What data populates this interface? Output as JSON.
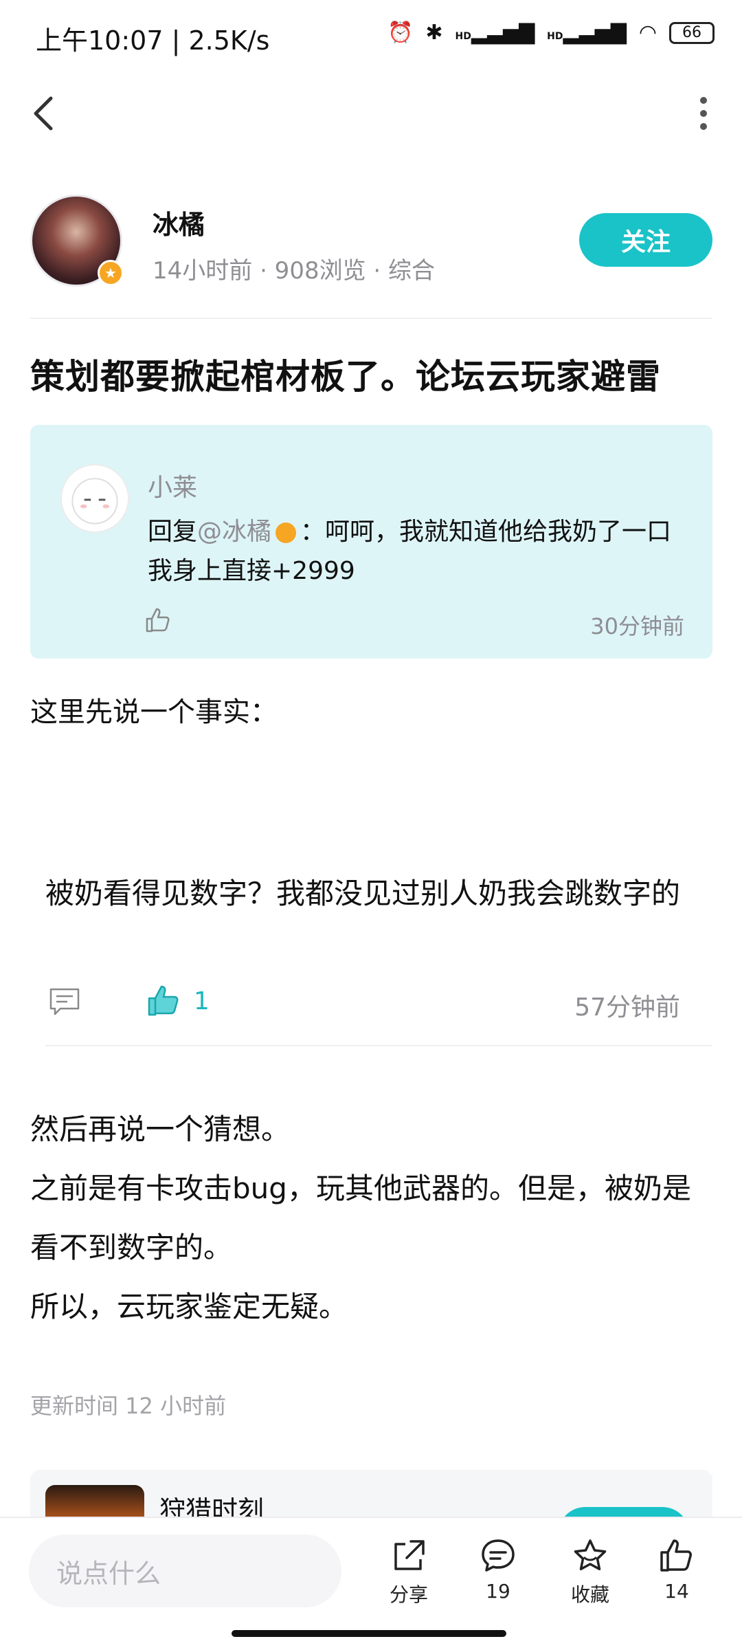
{
  "status_bar": {
    "time": "上午10:07 | 2.5K/s",
    "battery": "66",
    "hd1": "HD",
    "hd2": "HD"
  },
  "post": {
    "author": "冰橘",
    "meta": "14小时前 · 908浏览 · 综合",
    "follow_label": "关注",
    "title": "策划都要掀起棺材板了。论坛云玩家避雷",
    "quote": {
      "name": "小莱",
      "reply_prefix": "回复",
      "reply_at": "@冰橘",
      "text_after_badge": "：呵呵，我就知道他给我奶了一口 我身上直接+2999",
      "time": "30分钟前"
    },
    "para1": "这里先说一个事实：",
    "comment": {
      "text": "被奶看得见数字？我都没见过别人奶我会跳数字的",
      "like_count": "1",
      "time": "57分钟前"
    },
    "body_lines": [
      "然后再说一个猜想。",
      "之前是有卡攻击bug，玩其他武器的。但是，被奶是看不到数字的。",
      "所以，云玩家鉴定无疑。"
    ],
    "updated": "更新时间 12 小时前"
  },
  "related": {
    "name": "狩猎时刻"
  },
  "bottom_bar": {
    "placeholder": "说点什么",
    "share_label": "分享",
    "comment_count": "19",
    "favorite_label": "收藏",
    "like_count": "14"
  },
  "colors": {
    "accent": "#19c3c8",
    "quote_bg": "#def5f7",
    "badge": "#f6a623"
  }
}
